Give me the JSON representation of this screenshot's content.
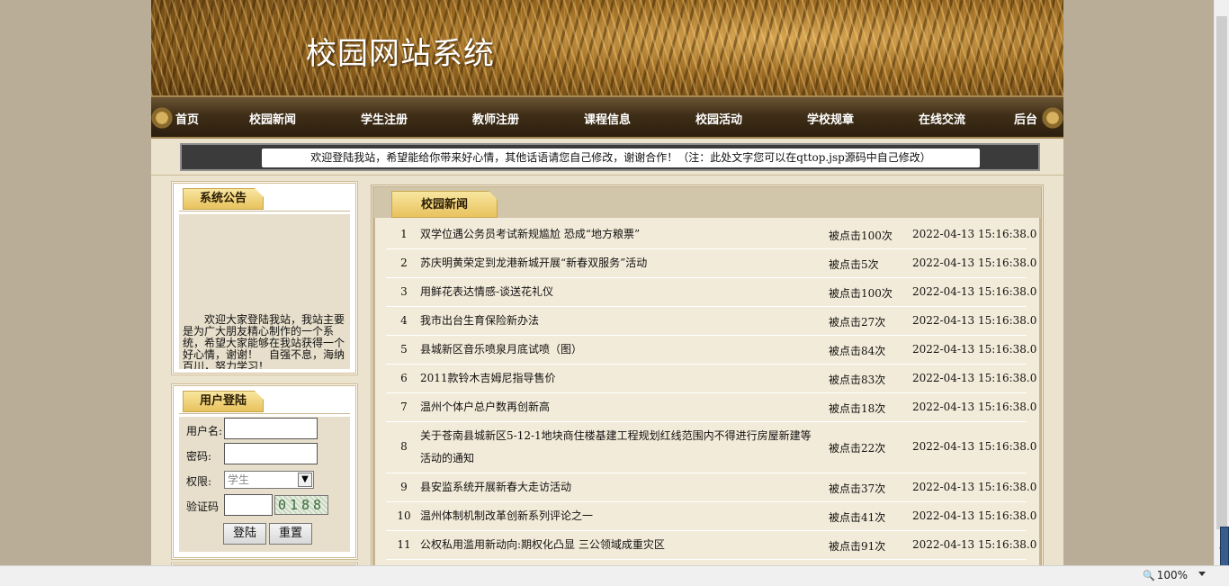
{
  "site": {
    "title": "校园网站系统"
  },
  "nav": {
    "items": [
      {
        "label": "首页"
      },
      {
        "label": "校园新闻"
      },
      {
        "label": "学生注册"
      },
      {
        "label": "教师注册"
      },
      {
        "label": "课程信息"
      },
      {
        "label": "校园活动"
      },
      {
        "label": "学校规章"
      },
      {
        "label": "在线交流"
      },
      {
        "label": "后台"
      }
    ]
  },
  "marquee": {
    "text": "欢迎登陆我站，希望能给你带来好心情，其他话语请您自己修改，谢谢合作！（注：此处文字您可以在qttop.jsp源码中自己修改）"
  },
  "notice": {
    "title": "系统公告",
    "text": "欢迎大家登陆我站，我站主要是为广大朋友精心制作的一个系统，希望大家能够在我站获得一个好心情，谢谢！　自强不息，海纳百川，努力学习！"
  },
  "login": {
    "title": "用户登陆",
    "username_label": "用户名:",
    "password_label": "密码:",
    "role_label": "权限:",
    "role_selected": "学生",
    "captcha_label": "验证码",
    "captcha_code": "0188",
    "login_button": "登陆",
    "reset_button": "重置"
  },
  "news": {
    "title": "校园新闻",
    "rows": [
      {
        "idx": "1",
        "title": "双学位遇公务员考试新规尴尬 恐成“地方粮票”",
        "hits": "被点击100次",
        "date": "2022-04-13 15:16:38.0"
      },
      {
        "idx": "2",
        "title": "苏庆明黄荣定到龙港新城开展“新春双服务”活动",
        "hits": "被点击5次",
        "date": "2022-04-13 15:16:38.0"
      },
      {
        "idx": "3",
        "title": "用鲜花表达情感-谈送花礼仪",
        "hits": "被点击100次",
        "date": "2022-04-13 15:16:38.0"
      },
      {
        "idx": "4",
        "title": "我市出台生育保险新办法",
        "hits": "被点击27次",
        "date": "2022-04-13 15:16:38.0"
      },
      {
        "idx": "5",
        "title": "县城新区音乐喷泉月底试喷（图）",
        "hits": "被点击84次",
        "date": "2022-04-13 15:16:38.0"
      },
      {
        "idx": "6",
        "title": "2011款铃木吉姆尼指导售价",
        "hits": "被点击83次",
        "date": "2022-04-13 15:16:38.0"
      },
      {
        "idx": "7",
        "title": "温州个体户总户数再创新高",
        "hits": "被点击18次",
        "date": "2022-04-13 15:16:38.0"
      },
      {
        "idx": "8",
        "title": "关于苍南县城新区5-12-1地块商住楼基建工程规划红线范围内不得进行房屋新建等活动的通知",
        "hits": "被点击22次",
        "date": "2022-04-13 15:16:38.0"
      },
      {
        "idx": "9",
        "title": "县安监系统开展新春大走访活动",
        "hits": "被点击37次",
        "date": "2022-04-13 15:16:38.0"
      },
      {
        "idx": "10",
        "title": "温州体制机制改革创新系列评论之一",
        "hits": "被点击41次",
        "date": "2022-04-13 15:16:38.0"
      },
      {
        "idx": "11",
        "title": "公权私用滥用新动向:期权化凸显 三公领域成重灾区",
        "hits": "被点击91次",
        "date": "2022-04-13 15:16:38.0"
      }
    ]
  },
  "status": {
    "zoom": "100%"
  }
}
